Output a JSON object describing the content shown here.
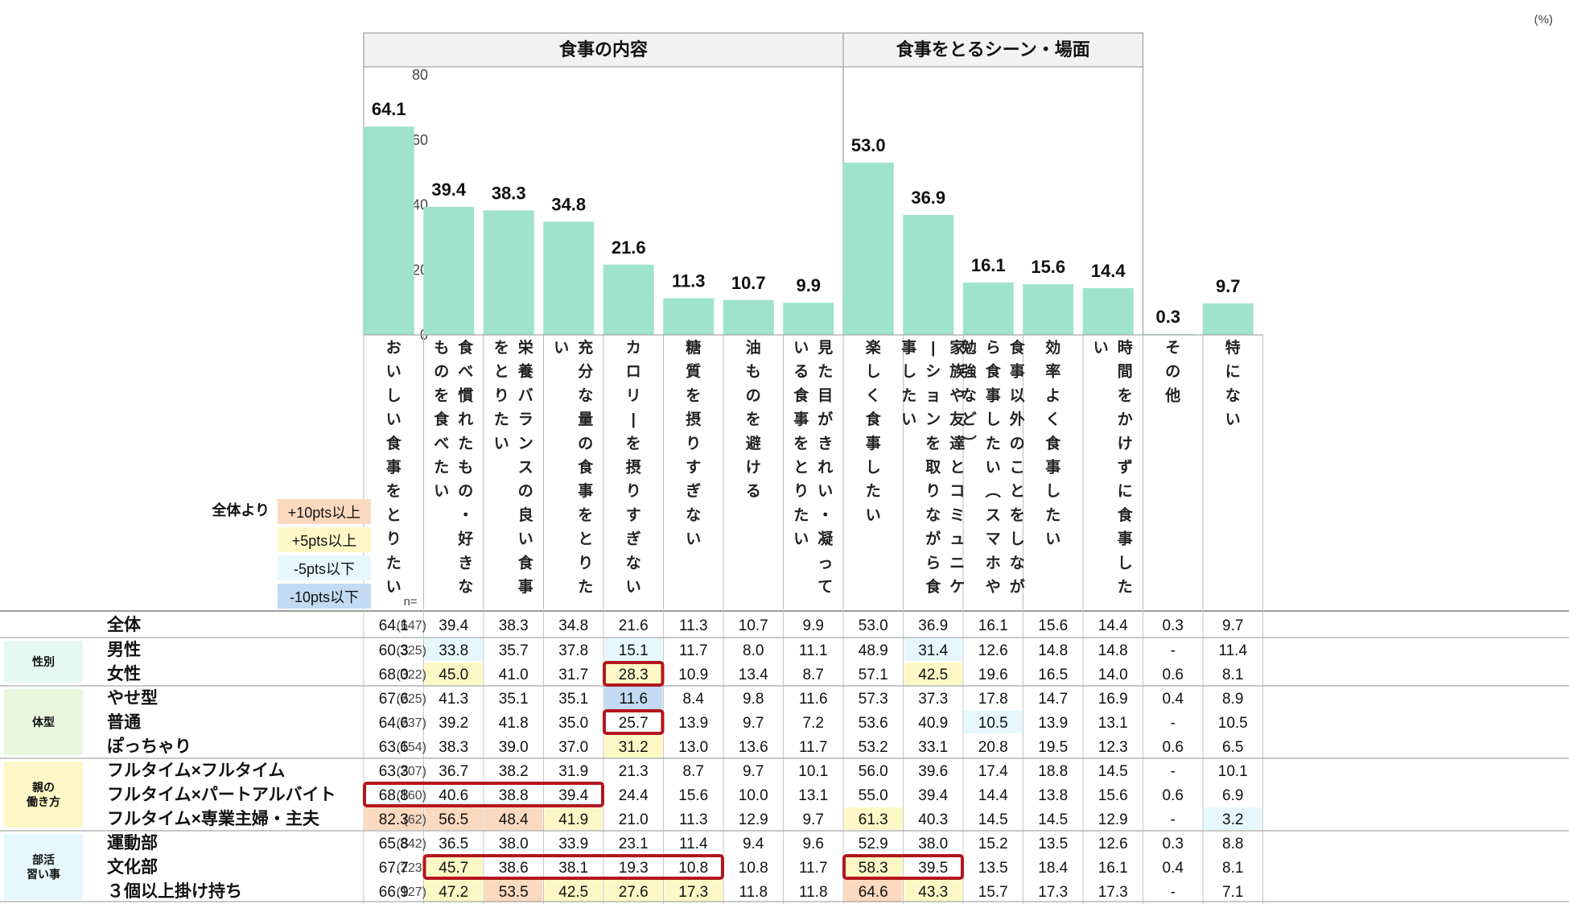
{
  "unit_label": "(%)",
  "colors": {
    "bar": "#9fe3cc",
    "plus10": "#fbd9bf",
    "plus5": "#fdf8c6",
    "minus5": "#e6f8fd",
    "minus10": "#c2dbf3",
    "highlight_box": "#b3161e",
    "group_bg_gender": "#e6f8f2",
    "group_bg_body": "#e9f7df",
    "group_bg_parent": "#fdf8c6",
    "group_bg_club": "#e6f8fd"
  },
  "legend": {
    "prefix": "全体より",
    "items": [
      {
        "label": "+10pts以上",
        "key": "plus10"
      },
      {
        "label": "+5pts以上",
        "key": "plus5"
      },
      {
        "label": "-5pts以下",
        "key": "minus5"
      },
      {
        "label": "-10pts以下",
        "key": "minus10"
      }
    ]
  },
  "n_header": "n=",
  "chart_data": {
    "type": "bar",
    "ylim": [
      0,
      80
    ],
    "yticks": [
      "0",
      "20",
      "40",
      "60",
      "80"
    ],
    "sections": [
      {
        "label": "食事の内容",
        "from": 0,
        "to": 7
      },
      {
        "label": "食事をとるシーン・場面",
        "from": 8,
        "to": 12
      }
    ],
    "categories": [
      "おいしい食事をとりたい",
      "食べ慣れたもの・好きなものを食べたい",
      "栄養バランスの良い食事をとりたい",
      "充分な量の食事をとりたい",
      "カロリーを摂りすぎない",
      "糖質を摂りすぎない",
      "油ものを避ける",
      "見た目がきれい・凝っている食事をとりたい",
      "楽しく食事したい",
      "家族や友達とコミュニケーションを取りながら食事したい",
      "食事以外のことをしながら食事したい（スマホや勉強など）",
      "効率よく食事したい",
      "時間をかけずに食事したい",
      "その他",
      "特にない"
    ],
    "values": [
      64.1,
      39.4,
      38.3,
      34.8,
      21.6,
      11.3,
      10.7,
      9.9,
      53.0,
      36.9,
      16.1,
      15.6,
      14.4,
      0.3,
      9.7
    ],
    "value_labels": [
      "64.1",
      "39.4",
      "38.3",
      "34.8",
      "21.6",
      "11.3",
      "10.7",
      "9.9",
      "53.0",
      "36.9",
      "16.1",
      "15.6",
      "14.4",
      "0.3",
      "9.7"
    ]
  },
  "table": {
    "total": {
      "label": "全体",
      "n": "(647)",
      "values": [
        "64.1",
        "39.4",
        "38.3",
        "34.8",
        "21.6",
        "11.3",
        "10.7",
        "9.9",
        "53.0",
        "36.9",
        "16.1",
        "15.6",
        "14.4",
        "0.3",
        "9.7"
      ]
    },
    "groups": [
      {
        "label": [
          "性別"
        ],
        "bg": "group_bg_gender",
        "rows": [
          {
            "label": "男性",
            "n": "(325)",
            "values": [
              "60.3",
              "33.8",
              "35.7",
              "37.8",
              "15.1",
              "11.7",
              "8.0",
              "11.1",
              "48.9",
              "31.4",
              "12.6",
              "14.8",
              "14.8",
              "-",
              "11.4"
            ],
            "shade": [
              null,
              "minus5",
              null,
              null,
              "minus5",
              null,
              null,
              null,
              null,
              "minus5",
              null,
              null,
              null,
              null,
              null
            ]
          },
          {
            "label": "女性",
            "n": "(322)",
            "values": [
              "68.0",
              "45.0",
              "41.0",
              "31.7",
              "28.3",
              "10.9",
              "13.4",
              "8.7",
              "57.1",
              "42.5",
              "19.6",
              "16.5",
              "14.0",
              "0.6",
              "8.1"
            ],
            "shade": [
              null,
              "plus5",
              null,
              null,
              "plus5",
              null,
              null,
              null,
              null,
              "plus5",
              null,
              null,
              null,
              null,
              null
            ]
          }
        ]
      },
      {
        "label": [
          "体型"
        ],
        "bg": "group_bg_body",
        "rows": [
          {
            "label": "やせ型",
            "n": "(225)",
            "values": [
              "67.6",
              "41.3",
              "35.1",
              "35.1",
              "11.6",
              "8.4",
              "9.8",
              "11.6",
              "57.3",
              "37.3",
              "17.8",
              "14.7",
              "16.9",
              "0.4",
              "8.9"
            ],
            "shade": [
              null,
              null,
              null,
              null,
              "minus10",
              null,
              null,
              null,
              null,
              null,
              null,
              null,
              null,
              null,
              null
            ]
          },
          {
            "label": "普通",
            "n": "(237)",
            "values": [
              "64.6",
              "39.2",
              "41.8",
              "35.0",
              "25.7",
              "13.9",
              "9.7",
              "7.2",
              "53.6",
              "40.9",
              "10.5",
              "13.9",
              "13.1",
              "-",
              "10.5"
            ],
            "shade": [
              null,
              null,
              null,
              null,
              null,
              null,
              null,
              null,
              null,
              null,
              "minus5",
              null,
              null,
              null,
              null
            ]
          },
          {
            "label": "ぽっちゃり",
            "n": "(154)",
            "values": [
              "63.6",
              "38.3",
              "39.0",
              "37.0",
              "31.2",
              "13.0",
              "13.6",
              "11.7",
              "53.2",
              "33.1",
              "20.8",
              "19.5",
              "12.3",
              "0.6",
              "6.5"
            ],
            "shade": [
              null,
              null,
              null,
              null,
              "plus5",
              null,
              null,
              null,
              null,
              null,
              null,
              null,
              null,
              null,
              null
            ]
          }
        ]
      },
      {
        "label": [
          "親の",
          "働き方"
        ],
        "bg": "group_bg_parent",
        "rows": [
          {
            "label": "フルタイム×フルタイム",
            "n": "(207)",
            "values": [
              "63.3",
              "36.7",
              "38.2",
              "31.9",
              "21.3",
              "8.7",
              "9.7",
              "10.1",
              "56.0",
              "39.6",
              "17.4",
              "18.8",
              "14.5",
              "-",
              "10.1"
            ],
            "shade": [
              null,
              null,
              null,
              null,
              null,
              null,
              null,
              null,
              null,
              null,
              null,
              null,
              null,
              null,
              null
            ]
          },
          {
            "label": "フルタイム×パートアルバイト",
            "n": "(160)",
            "values": [
              "68.8",
              "40.6",
              "38.8",
              "39.4",
              "24.4",
              "15.6",
              "10.0",
              "13.1",
              "55.0",
              "39.4",
              "14.4",
              "13.8",
              "15.6",
              "0.6",
              "6.9"
            ],
            "shade": [
              null,
              null,
              null,
              null,
              null,
              null,
              null,
              null,
              null,
              null,
              null,
              null,
              null,
              null,
              null
            ]
          },
          {
            "label": "フルタイム×専業主婦・主夫",
            "n": "(62)",
            "values": [
              "82.3",
              "56.5",
              "48.4",
              "41.9",
              "21.0",
              "11.3",
              "12.9",
              "9.7",
              "61.3",
              "40.3",
              "14.5",
              "14.5",
              "12.9",
              "-",
              "3.2"
            ],
            "shade": [
              "plus10",
              "plus10",
              "plus10",
              "plus5",
              null,
              null,
              null,
              null,
              "plus5",
              null,
              null,
              null,
              null,
              null,
              "minus5"
            ]
          }
        ]
      },
      {
        "label": [
          "部活",
          "習い事"
        ],
        "bg": "group_bg_club",
        "rows": [
          {
            "label": "運動部",
            "n": "(342)",
            "values": [
              "65.8",
              "36.5",
              "38.0",
              "33.9",
              "23.1",
              "11.4",
              "9.4",
              "9.6",
              "52.9",
              "38.0",
              "15.2",
              "13.5",
              "12.6",
              "0.3",
              "8.8"
            ],
            "shade": [
              null,
              null,
              null,
              null,
              null,
              null,
              null,
              null,
              null,
              null,
              null,
              null,
              null,
              null,
              null
            ]
          },
          {
            "label": "文化部",
            "n": "(223)",
            "values": [
              "67.7",
              "45.7",
              "38.6",
              "38.1",
              "19.3",
              "10.8",
              "10.8",
              "11.7",
              "58.3",
              "39.5",
              "13.5",
              "18.4",
              "16.1",
              "0.4",
              "8.1"
            ],
            "shade": [
              null,
              "plus5",
              null,
              null,
              null,
              null,
              null,
              null,
              "plus5",
              null,
              null,
              null,
              null,
              null,
              null
            ]
          },
          {
            "label": "３個以上掛け持ち",
            "n": "(127)",
            "values": [
              "66.9",
              "47.2",
              "53.5",
              "42.5",
              "27.6",
              "17.3",
              "11.8",
              "11.8",
              "64.6",
              "43.3",
              "15.7",
              "17.3",
              "17.3",
              "-",
              "7.1"
            ],
            "shade": [
              null,
              "plus5",
              "plus10",
              "plus5",
              "plus5",
              "plus5",
              null,
              null,
              "plus10",
              "plus5",
              null,
              null,
              null,
              null,
              null
            ]
          }
        ]
      }
    ],
    "highlight_boxes": [
      {
        "row": 2,
        "from": 4,
        "to": 4
      },
      {
        "row": 4,
        "from": 4,
        "to": 4
      },
      {
        "row": 7,
        "from": 0,
        "to": 3
      },
      {
        "row": 10,
        "from": 1,
        "to": 5
      },
      {
        "row": 10,
        "from": 8,
        "to": 9
      }
    ]
  }
}
